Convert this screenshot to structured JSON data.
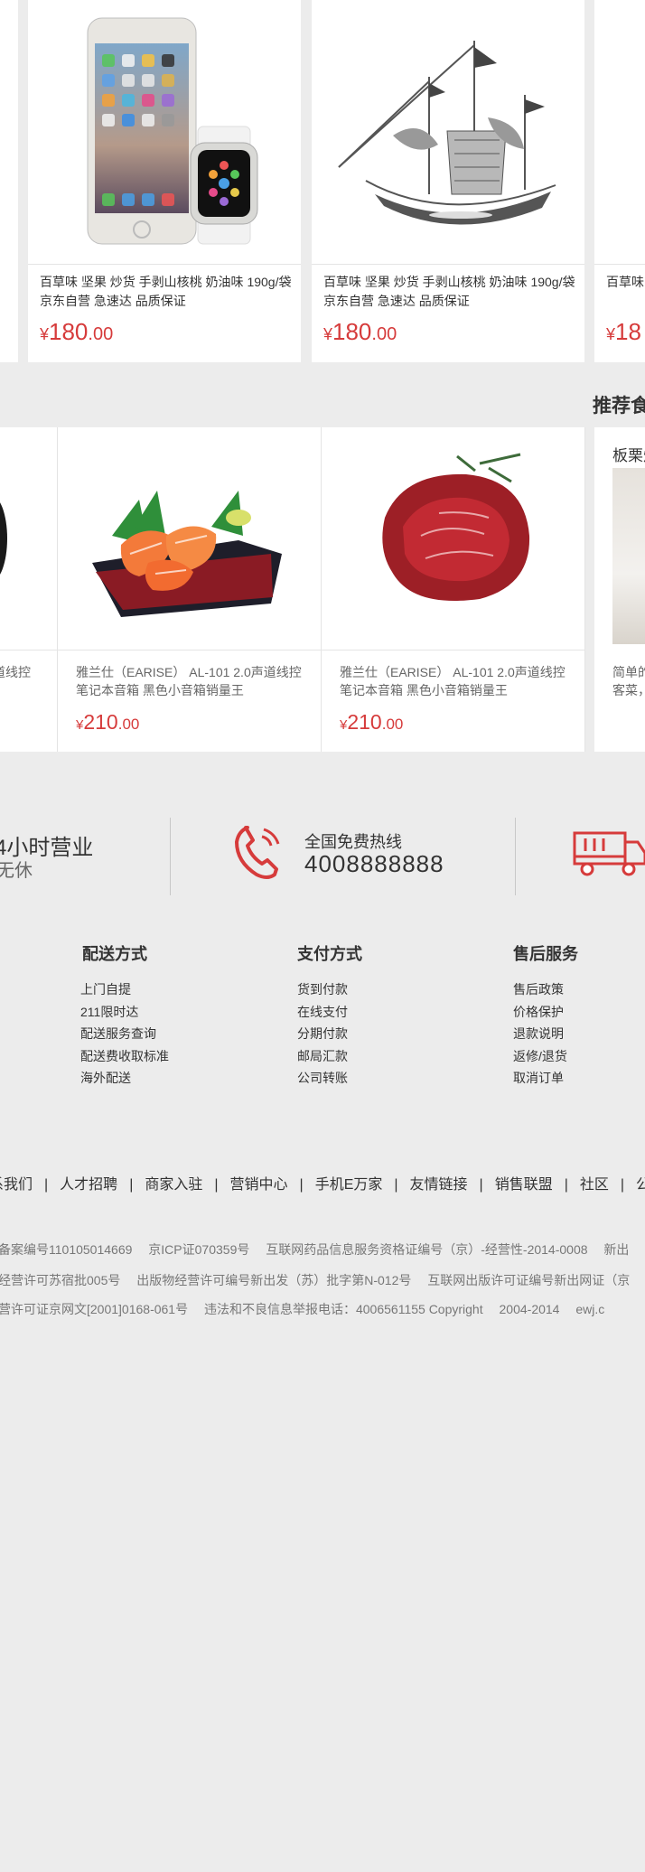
{
  "products_row1": [
    {
      "title": "百草味 坚果 炒货 手剥山核桃 奶油味 190g/袋京东自营 急速达 品质保证",
      "currency": "¥",
      "price_int": "180",
      "price_dec": ".00",
      "image": "phone-and-watch-image"
    },
    {
      "title": "百草味 坚果 炒货 手剥山核桃 奶油味 190g/袋京东自营 急速达 品质保证",
      "currency": "¥",
      "price_int": "180",
      "price_dec": ".00",
      "image": "ship-model-image"
    },
    {
      "title": "百草味",
      "currency": "¥",
      "price_int": "18",
      "price_dec": "",
      "image": ""
    }
  ],
  "recommend": {
    "title": "推荐食",
    "items": [
      {
        "title": "道线控",
        "currency": "",
        "price_int": "",
        "price_dec": ""
      },
      {
        "title": "雅兰仕（EARISE） AL-101 2.0声道线控笔记本音箱 黑色小音箱销量王",
        "currency": "¥",
        "price_int": "210",
        "price_dec": ".00",
        "image": "salmon-sashimi-image"
      },
      {
        "title": "雅兰仕（EARISE） AL-101 2.0声道线控笔记本音箱 黑色小音箱销量王",
        "currency": "¥",
        "price_int": "210",
        "price_dec": ".00",
        "image": "raw-beef-image"
      }
    ],
    "side_card": {
      "heading": "板栗烧",
      "line1": "简单的",
      "line2": "客菜，"
    }
  },
  "services": {
    "hours_title": "4小时营业",
    "hours_sub": "无休",
    "hotline_label": "全国免费热线",
    "hotline_number": "4008888888"
  },
  "columns": [
    {
      "title": "配送方式",
      "items": [
        "上门自提",
        "211限时达",
        "配送服务查询",
        "配送费收取标准",
        "海外配送"
      ]
    },
    {
      "title": "支付方式",
      "items": [
        "货到付款",
        "在线支付",
        "分期付款",
        "邮局汇款",
        "公司转账"
      ]
    },
    {
      "title": "售后服务",
      "items": [
        "售后政策",
        "价格保护",
        "退款说明",
        "返修/退货",
        "取消订单"
      ]
    }
  ],
  "bottom_nav": [
    "系我们",
    "人才招聘",
    "商家入驻",
    "营销中心",
    "手机E万家",
    "友情链接",
    "销售联盟",
    "社区",
    "公益"
  ],
  "legal": {
    "line1": [
      "备案编号110105014669",
      "京ICP证070359号",
      "互联网药品信息服务资格证编号（京）-经营性-2014-0008",
      "新出"
    ],
    "line2": [
      "经营许可苏宿批005号",
      "出版物经营许可编号新出发（苏）批字第N-012号",
      "互联网出版许可证编号新出网证（京"
    ],
    "line3": [
      "营许可证京网文[2001]0168-061号",
      "违法和不良信息举报电话：4006561155 Copyright",
      "2004-2014",
      "ewj.c"
    ]
  },
  "colors": {
    "accent": "#d63b3b",
    "background": "#ececec"
  }
}
